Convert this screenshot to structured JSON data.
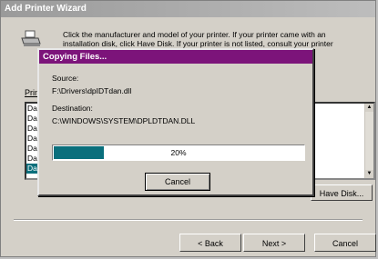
{
  "wizard": {
    "title": "Add Printer Wizard",
    "instructions": "Click the manufacturer and model of your printer. If your printer came with an installation disk, click Have Disk. If your printer is not listed, consult your printer",
    "manufacturers_label": "Print",
    "manufacturers": [
      "Dat",
      "Dat",
      "Dat",
      "Dat",
      "Dat",
      "Dat",
      "Dat"
    ],
    "selected_index": 6,
    "have_disk_label": "Have Disk...",
    "back_label": "< Back",
    "next_label": "Next >",
    "cancel_label": "Cancel"
  },
  "dialog": {
    "title": "Copying Files...",
    "source_label": "Source:",
    "source_path": "F:\\Drivers\\dpIDTdan.dll",
    "destination_label": "Destination:",
    "destination_path": "C:\\WINDOWS\\SYSTEM\\DPLDTDAN.DLL",
    "progress_percent": 20,
    "progress_text": "20%",
    "cancel_label": "Cancel"
  },
  "colors": {
    "dialog_titlebar": "#7c147a",
    "progress_fill": "#0a6f7c",
    "selection": "#0a6f7c"
  }
}
